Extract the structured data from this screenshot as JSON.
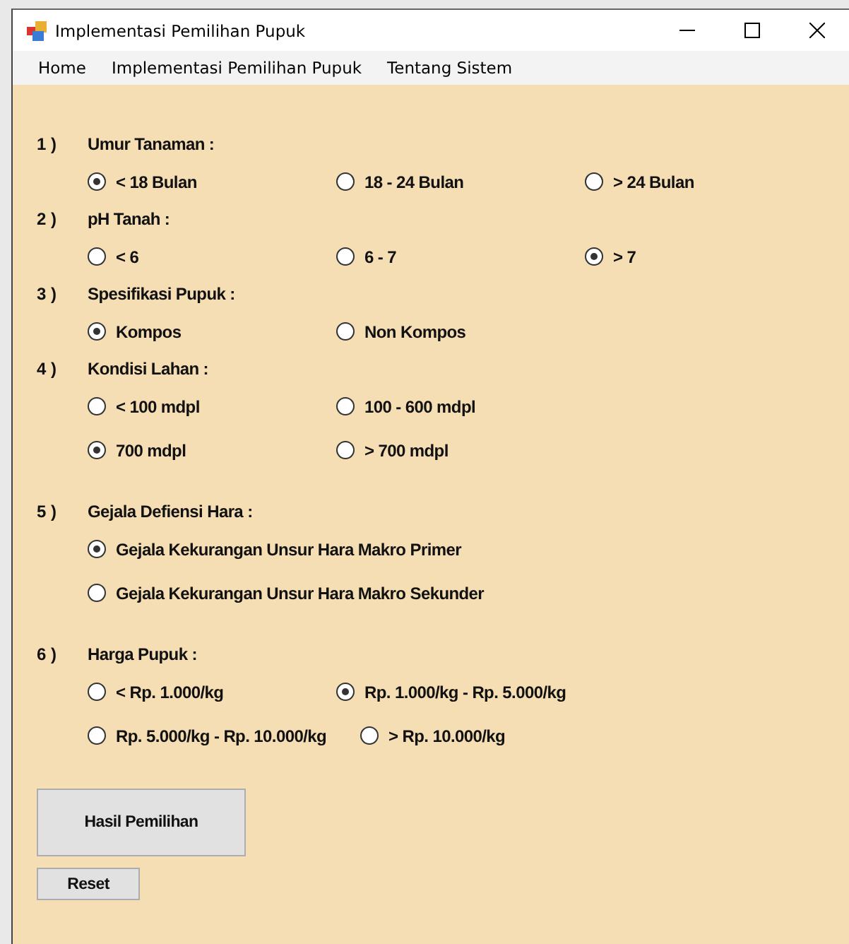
{
  "window": {
    "title": "Implementasi Pemilihan Pupuk"
  },
  "menu": [
    "Home",
    "Implementasi Pemilihan Pupuk",
    "Tentang Sistem"
  ],
  "questions": [
    {
      "number": "1 )",
      "label": "Umur Tanaman :",
      "rows": [
        [
          {
            "label": "< 18 Bulan",
            "selected": true
          },
          {
            "label": "18 - 24 Bulan",
            "selected": false
          },
          {
            "label": "> 24 Bulan",
            "selected": false
          }
        ]
      ]
    },
    {
      "number": "2 )",
      "label": "pH Tanah :",
      "rows": [
        [
          {
            "label": "< 6",
            "selected": false
          },
          {
            "label": "6 - 7",
            "selected": false
          },
          {
            "label": "> 7",
            "selected": true
          }
        ]
      ]
    },
    {
      "number": "3 )",
      "label": "Spesifikasi Pupuk :",
      "rows": [
        [
          {
            "label": "Kompos",
            "selected": true
          },
          {
            "label": "Non Kompos",
            "selected": false
          }
        ]
      ]
    },
    {
      "number": "4 )",
      "label": "Kondisi Lahan :",
      "rows": [
        [
          {
            "label": "< 100 mdpl",
            "selected": false
          },
          {
            "label": "100 - 600 mdpl",
            "selected": false
          }
        ],
        [
          {
            "label": "700 mdpl",
            "selected": true
          },
          {
            "label": "> 700 mdpl",
            "selected": false
          }
        ]
      ]
    },
    {
      "number": "5 )",
      "label": "Gejala Defiensi Hara :",
      "rows": [
        [
          {
            "label": "Gejala Kekurangan Unsur Hara Makro Primer",
            "selected": true
          }
        ],
        [
          {
            "label": "Gejala Kekurangan Unsur Hara Makro Sekunder",
            "selected": false
          }
        ]
      ]
    },
    {
      "number": "6 )",
      "label": "Harga Pupuk :",
      "rows": [
        [
          {
            "label": "< Rp. 1.000/kg",
            "selected": false
          },
          {
            "label": "Rp. 1.000/kg - Rp. 5.000/kg",
            "selected": true
          }
        ],
        [
          {
            "label": "Rp. 5.000/kg - Rp. 10.000/kg",
            "selected": false
          },
          {
            "label": "> Rp. 10.000/kg",
            "selected": false
          }
        ]
      ]
    }
  ],
  "buttons": {
    "primary": "Hasil Pemilihan",
    "secondary": "Reset"
  }
}
